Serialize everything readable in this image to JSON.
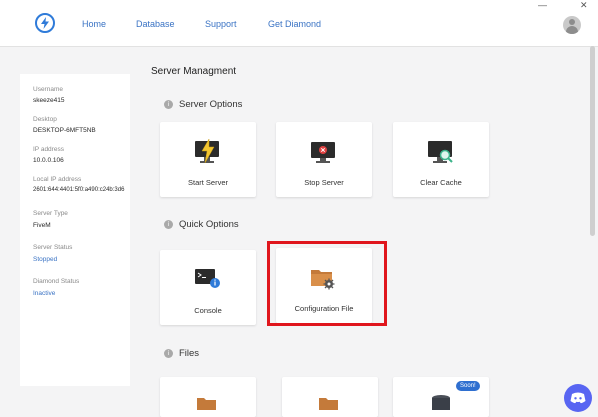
{
  "nav": {
    "home": "Home",
    "database": "Database",
    "support": "Support",
    "get_diamond": "Get Diamond"
  },
  "window": {
    "minimize": "—",
    "close": "✕"
  },
  "sidebar": {
    "username_label": "Username",
    "username_value": "skeeze415",
    "desktop_label": "Desktop",
    "desktop_value": "DESKTOP-6MFT5NB",
    "ip_label": "IP address",
    "ip_value": "10.0.0.106",
    "local_ip_label": "Local IP address",
    "local_ip_value": "2601:644:4401:5f0:a490:c24b:3d6",
    "server_type_label": "Server Type",
    "server_type_value": "FiveM",
    "server_status_label": "Server Status",
    "server_status_value": "Stopped",
    "diamond_status_label": "Diamond Status",
    "diamond_status_value": "Inactive"
  },
  "main": {
    "title": "Server Managment",
    "server_options_title": "Server Options",
    "quick_options_title": "Quick Options",
    "files_title": "Files",
    "server_options": [
      {
        "label": "Start Server",
        "icon": "lightning-monitor-icon"
      },
      {
        "label": "Stop Server",
        "icon": "stop-monitor-icon"
      },
      {
        "label": "Clear Cache",
        "icon": "search-monitor-icon"
      }
    ],
    "quick_options": [
      {
        "label": "Console",
        "icon": "console-icon"
      },
      {
        "label": "Configuration File",
        "icon": "folder-gear-icon"
      }
    ],
    "files_badge": "Soon!",
    "info_glyph": "i"
  },
  "colors": {
    "accent": "#3a73c4",
    "highlight": "#e0161d",
    "badge": "#2f6fd0",
    "discord": "#5865f2"
  }
}
